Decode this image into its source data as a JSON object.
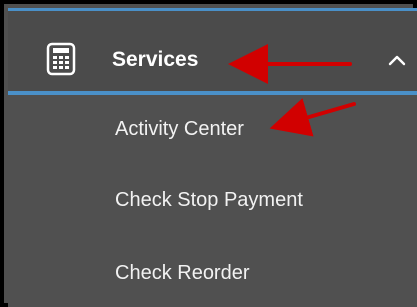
{
  "menu": {
    "section_label": "Services",
    "section_icon": "calculator-icon",
    "collapse_icon": "chevron-up-icon",
    "items": [
      {
        "label": "Activity Center"
      },
      {
        "label": "Check Stop Payment"
      },
      {
        "label": "Check Reorder"
      }
    ]
  },
  "annotations": {
    "arrow_icon": "red-arrow-annotation",
    "arrow_color": "#d10000"
  },
  "colors": {
    "accent": "#4a90c8",
    "header_bg": "#4b4b4b",
    "submenu_bg": "#505050",
    "text": "#ffffff"
  }
}
